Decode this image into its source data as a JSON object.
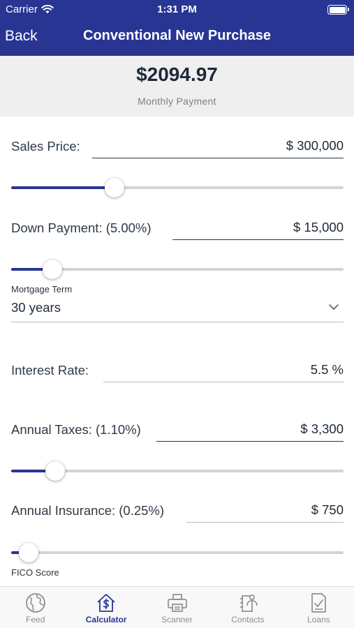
{
  "status_bar": {
    "carrier": "Carrier",
    "time": "1:31 PM"
  },
  "nav": {
    "back_label": "Back",
    "title": "Conventional New Purchase"
  },
  "summary": {
    "amount": "$2094.97",
    "label": "Monthly Payment"
  },
  "form": {
    "sales_price": {
      "label": "Sales Price:",
      "value": "$ 300,000",
      "slider_fraction": 0.3
    },
    "down_payment": {
      "label": "Down Payment: (5.00%)",
      "value": "$ 15,000",
      "slider_fraction": 0.1
    },
    "mortgage_term": {
      "label": "Mortgage Term",
      "value": "30 years"
    },
    "interest_rate": {
      "label": "Interest Rate:",
      "value": "5.5 %"
    },
    "annual_taxes": {
      "label": "Annual Taxes: (1.10%)",
      "value": "$ 3,300",
      "slider_fraction": 0.11
    },
    "annual_insurance": {
      "label": "Annual Insurance: (0.25%)",
      "value": "$ 750",
      "slider_fraction": 0.025
    },
    "fico_score": {
      "label": "FICO Score"
    }
  },
  "tabs": [
    {
      "label": "Feed",
      "icon": "globe-icon",
      "active": false
    },
    {
      "label": "Calculator",
      "icon": "house-dollar-icon",
      "active": true
    },
    {
      "label": "Scanner",
      "icon": "printer-icon",
      "active": false
    },
    {
      "label": "Contacts",
      "icon": "contacts-icon",
      "active": false
    },
    {
      "label": "Loans",
      "icon": "document-check-icon",
      "active": false
    }
  ],
  "colors": {
    "brand": "#283593",
    "tab_inactive": "#8e8e93",
    "track": "#d4d4d4"
  }
}
